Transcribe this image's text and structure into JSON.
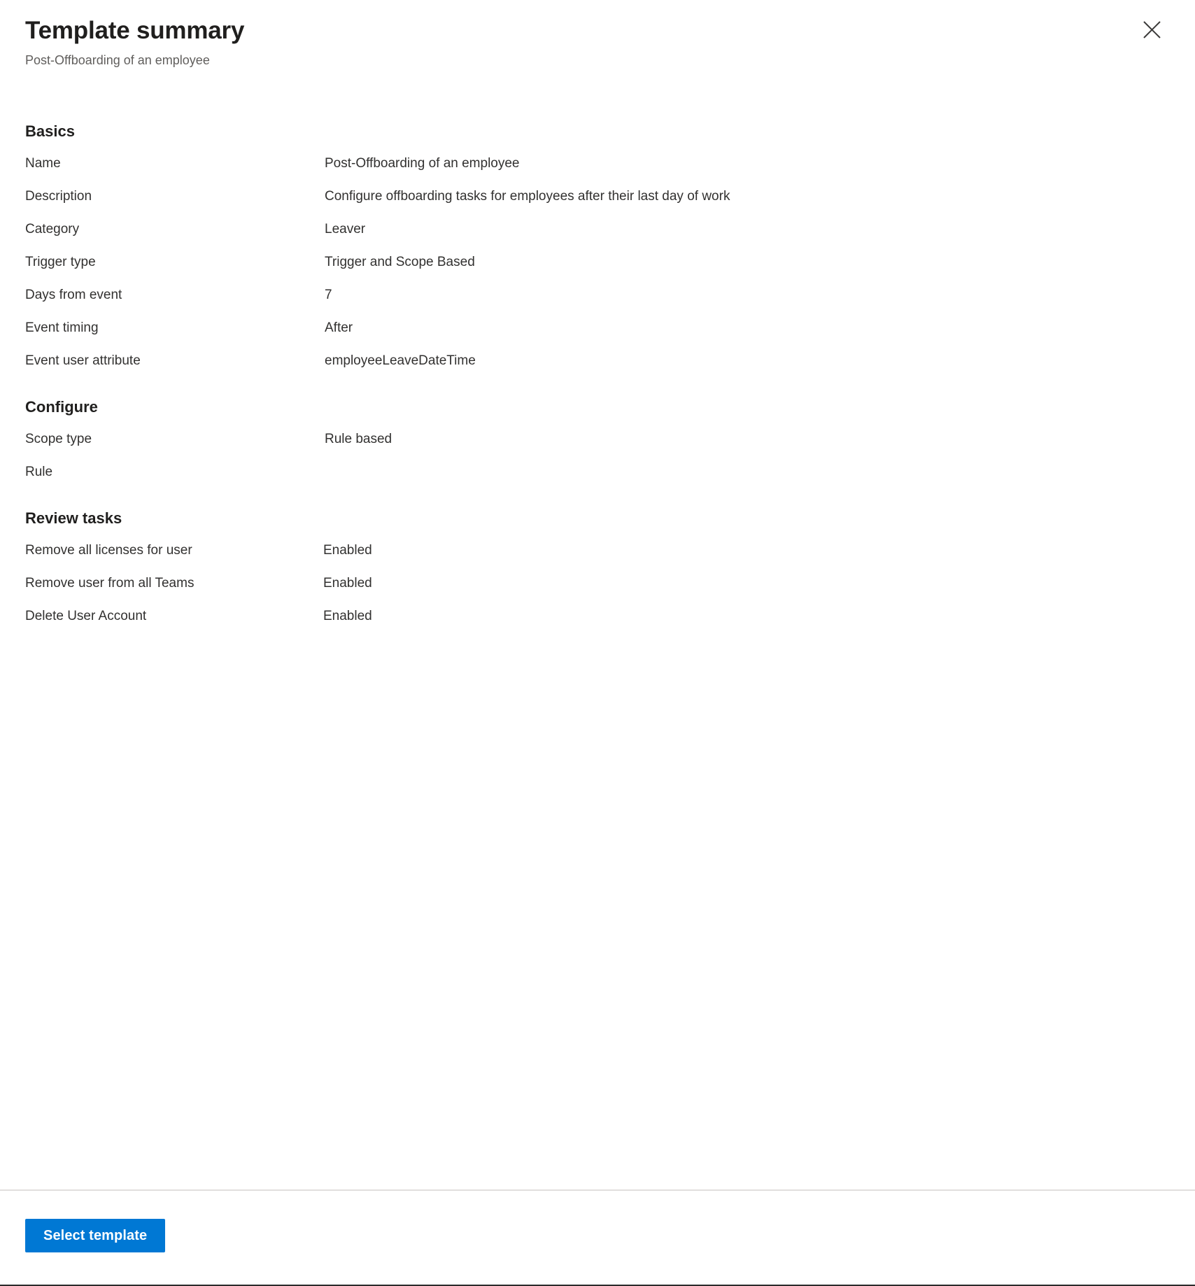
{
  "header": {
    "title": "Template summary",
    "subtitle": "Post-Offboarding of an employee",
    "close_icon": "close-icon",
    "close_label": "Close"
  },
  "sections": [
    {
      "id": "basics",
      "heading": "Basics",
      "rows": [
        {
          "label": "Name",
          "value": "Post-Offboarding of an employee"
        },
        {
          "label": "Description",
          "value": "Configure offboarding tasks for employees after their last day of work"
        },
        {
          "label": "Category",
          "value": "Leaver"
        },
        {
          "label": "Trigger type",
          "value": "Trigger and Scope Based"
        },
        {
          "label": "Days from event",
          "value": "7"
        },
        {
          "label": "Event timing",
          "value": "After"
        },
        {
          "label": "Event user attribute",
          "value": "employeeLeaveDateTime"
        }
      ]
    },
    {
      "id": "configure",
      "heading": "Configure",
      "rows": [
        {
          "label": "Scope type",
          "value": "Rule based"
        },
        {
          "label": "Rule",
          "value": ""
        }
      ]
    },
    {
      "id": "review-tasks",
      "heading": "Review tasks",
      "rows": [
        {
          "label": "Remove all licenses for user",
          "value": "Enabled"
        },
        {
          "label": "Remove user from all Teams",
          "value": "Enabled"
        },
        {
          "label": "Delete User Account",
          "value": "Enabled"
        }
      ]
    }
  ],
  "footer": {
    "primary_button_label": "Select template"
  },
  "colors": {
    "accent": "#0078d4",
    "text_primary": "#323130",
    "text_secondary": "#605e5c",
    "divider": "#e1dfdd",
    "background": "#ffffff"
  }
}
